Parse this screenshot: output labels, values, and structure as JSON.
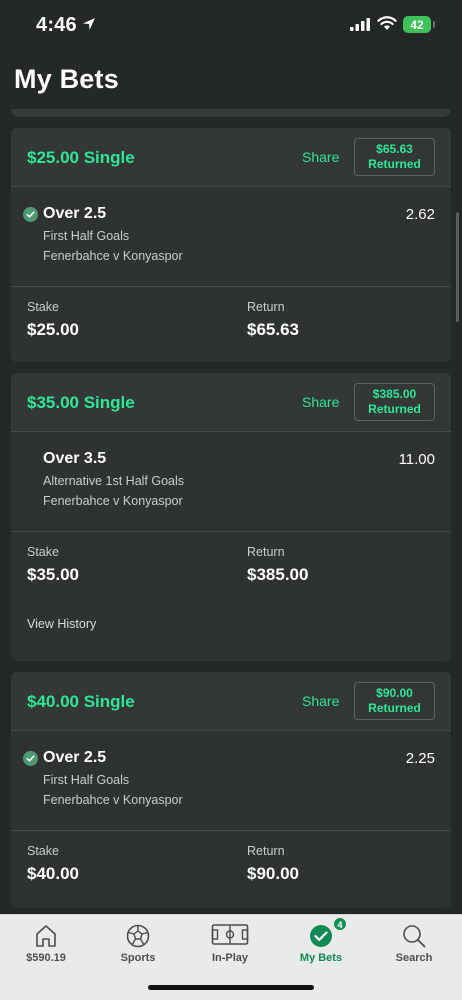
{
  "status_bar": {
    "time": "4:46",
    "battery": "42"
  },
  "header": {
    "title": "My Bets"
  },
  "bets": [
    {
      "title": "$25.00 Single",
      "share_label": "Share",
      "returned_amount": "$65.63",
      "returned_label": "Returned",
      "won": true,
      "selection": "Over 2.5",
      "odds": "2.62",
      "market": "First Half Goals",
      "event": "Fenerbahce v Konyaspor",
      "stake_label": "Stake",
      "stake": "$25.00",
      "return_label": "Return",
      "return_value": "$65.63"
    },
    {
      "title": "$35.00 Single",
      "share_label": "Share",
      "returned_amount": "$385.00",
      "returned_label": "Returned",
      "won": false,
      "selection": "Over 3.5",
      "odds": "11.00",
      "market": "Alternative 1st Half Goals",
      "event": "Fenerbahce v Konyaspor",
      "stake_label": "Stake",
      "stake": "$35.00",
      "return_label": "Return",
      "return_value": "$385.00",
      "view_history": "View History"
    },
    {
      "title": "$40.00 Single",
      "share_label": "Share",
      "returned_amount": "$90.00",
      "returned_label": "Returned",
      "won": true,
      "selection": "Over 2.5",
      "odds": "2.25",
      "market": "First Half Goals",
      "event": "Fenerbahce v Konyaspor",
      "stake_label": "Stake",
      "stake": "$40.00",
      "return_label": "Return",
      "return_value": "$90.00"
    }
  ],
  "tab_bar": {
    "tabs": [
      {
        "label": "$590.19",
        "icon": "home-icon"
      },
      {
        "label": "Sports",
        "icon": "soccer-ball-icon"
      },
      {
        "label": "In-Play",
        "icon": "pitch-icon"
      },
      {
        "label": "My Bets",
        "icon": "check-circle-icon",
        "badge": "4",
        "active": true
      },
      {
        "label": "Search",
        "icon": "search-icon"
      }
    ]
  },
  "colors": {
    "accent": "#2ee598",
    "background": "#242826",
    "card": "#2e3331",
    "tab_active": "#128a55"
  }
}
